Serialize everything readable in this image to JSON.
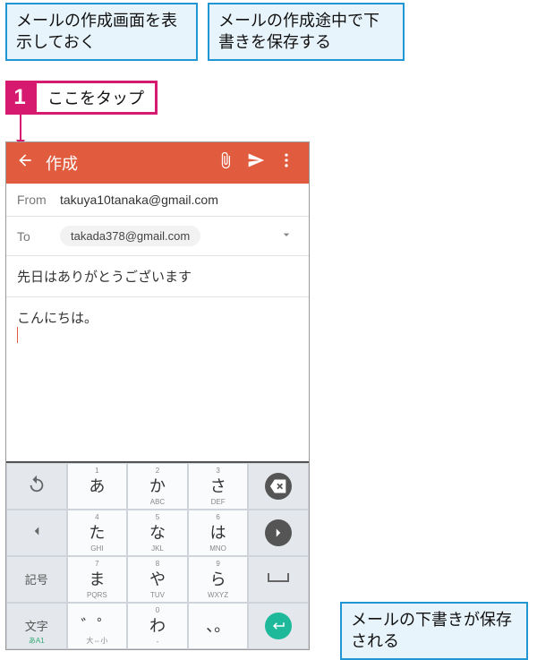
{
  "callouts": {
    "top_left": "メールの作成画面を表示しておく",
    "top_right": "メールの作成途中で下書きを保存する",
    "bottom_right": "メールの下書きが保存される"
  },
  "step": {
    "number": "1",
    "label": "ここをタップ"
  },
  "appbar": {
    "title": "作成"
  },
  "compose": {
    "from_label": "From",
    "from_value": "takuya10tanaka@gmail.com",
    "to_label": "To",
    "to_value": "takada378@gmail.com",
    "subject": "先日はありがとうございます",
    "body": "こんにちは。"
  },
  "keyboard": {
    "rows": [
      [
        {
          "type": "func",
          "main": "",
          "icon": "undo"
        },
        {
          "type": "char",
          "top": "1",
          "main": "あ",
          "sub": ""
        },
        {
          "type": "char",
          "top": "2",
          "main": "か",
          "sub": "ABC"
        },
        {
          "type": "char",
          "top": "3",
          "main": "さ",
          "sub": "DEF"
        },
        {
          "type": "circle",
          "bg": "dark",
          "icon": "bksp"
        }
      ],
      [
        {
          "type": "func",
          "main": "",
          "icon": "left"
        },
        {
          "type": "char",
          "top": "4",
          "main": "た",
          "sub": "GHI"
        },
        {
          "type": "char",
          "top": "5",
          "main": "な",
          "sub": "JKL"
        },
        {
          "type": "char",
          "top": "6",
          "main": "は",
          "sub": "MNO"
        },
        {
          "type": "circle",
          "bg": "dark",
          "icon": "right"
        }
      ],
      [
        {
          "type": "func",
          "main": "記号",
          "small": true
        },
        {
          "type": "char",
          "top": "7",
          "main": "ま",
          "sub": "PQRS"
        },
        {
          "type": "char",
          "top": "8",
          "main": "や",
          "sub": "TUV"
        },
        {
          "type": "char",
          "top": "9",
          "main": "ら",
          "sub": "WXYZ"
        },
        {
          "type": "func",
          "main": "",
          "icon": "space"
        }
      ],
      [
        {
          "type": "func",
          "main": "文字",
          "sub2": "あA1",
          "small": true
        },
        {
          "type": "char",
          "top": "",
          "main": "゛゜",
          "sub": "大⇔小"
        },
        {
          "type": "char",
          "top": "0",
          "main": "わ",
          "sub": "-"
        },
        {
          "type": "char",
          "top": "",
          "main": "、。",
          "sub": ""
        },
        {
          "type": "circle",
          "bg": "green",
          "icon": "enter"
        }
      ]
    ]
  }
}
